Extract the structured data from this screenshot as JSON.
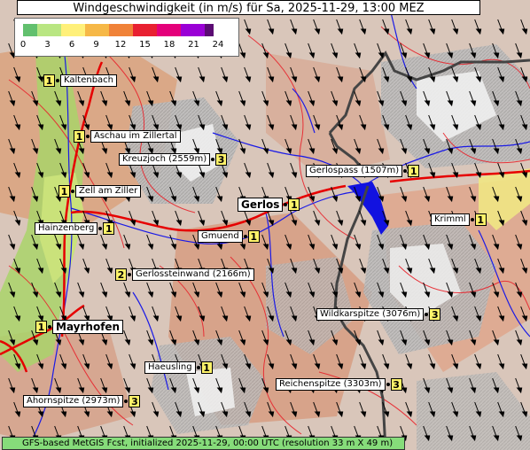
{
  "title": "Windgeschwindigkeit (in m/s) für Sa, 2025-11-29, 13:00 MEZ",
  "legend": {
    "ticks": [
      "0",
      "3",
      "6",
      "9",
      "12",
      "15",
      "18",
      "21",
      "24"
    ],
    "colors": [
      "#62c06e",
      "#b9e682",
      "#fff07a",
      "#f6b847",
      "#f08238",
      "#e82031",
      "#e4007a",
      "#9a00d6",
      "#5b0b73"
    ]
  },
  "places": [
    {
      "name": "Kaltenbach",
      "num": "1"
    },
    {
      "name": "Aschau im Zillertal",
      "num": "1"
    },
    {
      "name": "Kreuzjoch (2559m)",
      "num": "3"
    },
    {
      "name": "Zell am Ziller",
      "num": "1"
    },
    {
      "name": "Gerlos",
      "num": "1"
    },
    {
      "name": "Gerlospass (1507m)",
      "num": "1"
    },
    {
      "name": "Hainzenberg",
      "num": "1"
    },
    {
      "name": "Gmuend",
      "num": "1"
    },
    {
      "name": "Krimml",
      "num": "1"
    },
    {
      "name": "Gerlossteinwand (2166m)",
      "num": "2"
    },
    {
      "name": "Wildkarspitze (3076m)",
      "num": "3"
    },
    {
      "name": "Mayrhofen",
      "num": "1"
    },
    {
      "name": "Haeusling",
      "num": "1"
    },
    {
      "name": "Reichenspitze (3303m)",
      "num": "3"
    },
    {
      "name": "Ahornspitze (2973m)",
      "num": "3"
    }
  ],
  "footer": "GFS-based MetGIS Fcst, initialized 2025-11-29, 00:00 UTC  (resolution 33 m X 49 m)"
}
